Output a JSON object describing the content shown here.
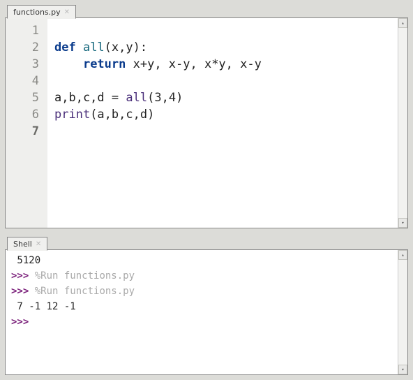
{
  "editor": {
    "tab_label": "functions.py",
    "line_numbers": [
      "1",
      "2",
      "3",
      "4",
      "5",
      "6",
      "7"
    ],
    "current_line_index": 6,
    "lines": [
      {
        "tokens": []
      },
      {
        "tokens": [
          {
            "t": "def ",
            "c": "kw"
          },
          {
            "t": "all",
            "c": "fn"
          },
          {
            "t": "(x,y):",
            "c": ""
          }
        ]
      },
      {
        "tokens": [
          {
            "t": "    ",
            "c": ""
          },
          {
            "t": "return",
            "c": "kw"
          },
          {
            "t": " x+y, x-y, x*y, x-y",
            "c": ""
          }
        ]
      },
      {
        "tokens": []
      },
      {
        "tokens": [
          {
            "t": "a,b,c,d = ",
            "c": ""
          },
          {
            "t": "all",
            "c": "call"
          },
          {
            "t": "(",
            "c": ""
          },
          {
            "t": "3",
            "c": "num"
          },
          {
            "t": ",",
            "c": ""
          },
          {
            "t": "4",
            "c": "num"
          },
          {
            "t": ")",
            "c": ""
          }
        ]
      },
      {
        "tokens": [
          {
            "t": "print",
            "c": "call"
          },
          {
            "t": "(a,b,c,d)",
            "c": ""
          }
        ]
      },
      {
        "tokens": []
      }
    ]
  },
  "shell": {
    "tab_label": "Shell",
    "lines": [
      {
        "parts": [
          {
            "t": " 5120",
            "c": ""
          }
        ]
      },
      {
        "parts": [
          {
            "t": ">>>",
            "c": "prompt"
          },
          {
            "t": " ",
            "c": ""
          },
          {
            "t": "%Run functions.py",
            "c": "magic"
          }
        ]
      },
      {
        "parts": [
          {
            "t": ">>>",
            "c": "prompt"
          },
          {
            "t": " ",
            "c": ""
          },
          {
            "t": "%Run functions.py",
            "c": "magic"
          }
        ]
      },
      {
        "parts": [
          {
            "t": " 7 -1 12 -1",
            "c": ""
          }
        ]
      },
      {
        "parts": [
          {
            "t": ">>>",
            "c": "prompt"
          }
        ]
      }
    ]
  },
  "scrollbar_up": "▴",
  "scrollbar_down": "▾"
}
